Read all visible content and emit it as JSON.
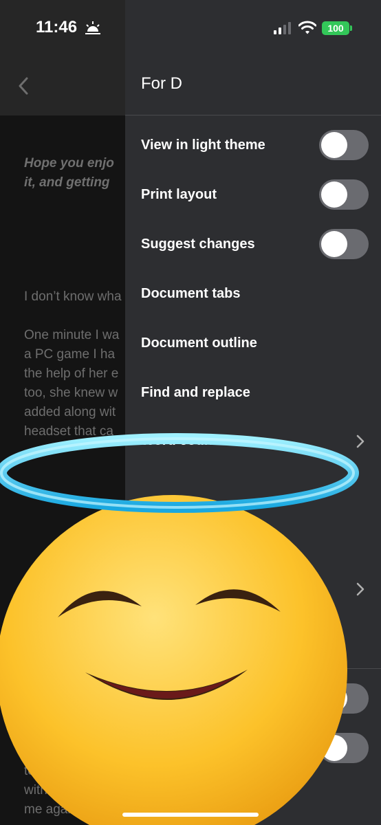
{
  "status_bar": {
    "time": "11:46",
    "battery": "100",
    "icons": [
      "sunrise-icon",
      "cellular-signal-icon",
      "wifi-icon",
      "battery-icon"
    ]
  },
  "document": {
    "back_icon": "chevron-left-icon",
    "intro_lines": [
      "Hope you enjo",
      "it, and getting"
    ],
    "body_lines": [
      "I don’t know wha",
      "One minute I wa",
      "a PC game I ha",
      "the help of her e",
      "too, she knew w",
      "added along wit",
      "headset that ca",
      "teeth g",
      "with annoya",
      "me again. It had"
    ]
  },
  "panel": {
    "title": "For D",
    "items": [
      {
        "label": "View in light theme",
        "type": "toggle",
        "on": false
      },
      {
        "label": "Print layout",
        "type": "toggle",
        "on": false
      },
      {
        "label": "Suggest changes",
        "type": "toggle",
        "on": false
      },
      {
        "label": "Document tabs",
        "type": "link"
      },
      {
        "label": "Document outline",
        "type": "link"
      },
      {
        "label": "Find and replace",
        "type": "link"
      },
      {
        "label": "Word count",
        "type": "submenu"
      }
    ],
    "colors": {
      "background": "#2d2e31",
      "toggle_off": "#6a6b70",
      "battery": "#33c759"
    }
  },
  "overlay": {
    "emoji": "smiling-face-with-halo-emoji"
  }
}
